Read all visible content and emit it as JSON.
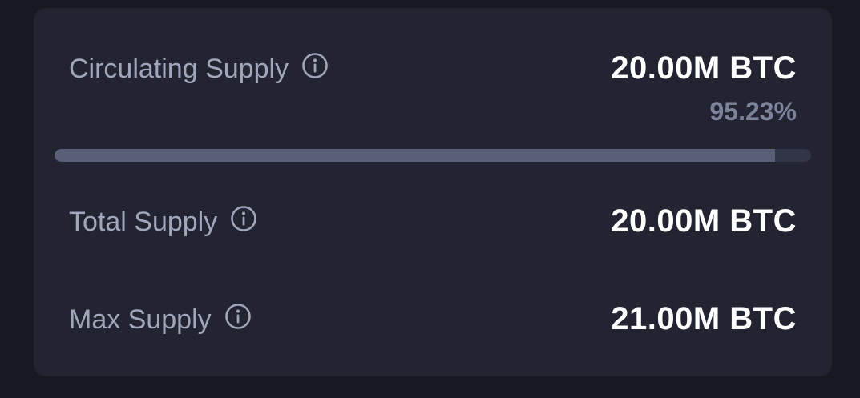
{
  "supply": {
    "circulating": {
      "label": "Circulating Supply",
      "value": "20.00M BTC",
      "percent_text": "95.23%",
      "progress_percent": 95.23
    },
    "total": {
      "label": "Total Supply",
      "value": "20.00M BTC"
    },
    "max": {
      "label": "Max Supply",
      "value": "21.00M BTC"
    }
  },
  "icons": {
    "info": "info-circle-icon"
  },
  "colors": {
    "background": "#171923",
    "card": "#222531",
    "label": "#a1a7bb",
    "value": "#ffffff",
    "muted": "#7d839a",
    "progress_track": "#323546",
    "progress_fill": "#5a5f78"
  }
}
